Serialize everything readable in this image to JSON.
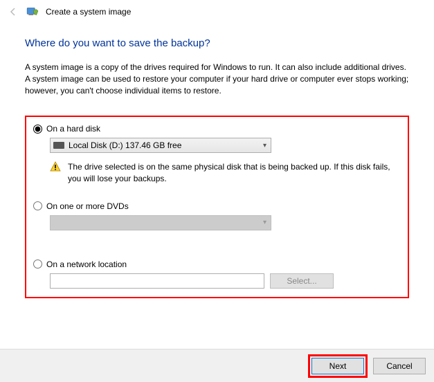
{
  "header": {
    "title": "Create a system image"
  },
  "main": {
    "heading": "Where do you want to save the backup?",
    "description": "A system image is a copy of the drives required for Windows to run. It can also include additional drives. A system image can be used to restore your computer if your hard drive or computer ever stops working; however, you can't choose individual items to restore."
  },
  "options": {
    "hard_disk": {
      "label": "On a hard disk",
      "selected_drive": "Local Disk (D:)  137.46 GB free",
      "warning": "The drive selected is on the same physical disk that is being backed up. If this disk fails, you will lose your backups."
    },
    "dvd": {
      "label": "On one or more DVDs"
    },
    "network": {
      "label": "On a network location",
      "select_button": "Select..."
    }
  },
  "footer": {
    "next": "Next",
    "cancel": "Cancel"
  }
}
